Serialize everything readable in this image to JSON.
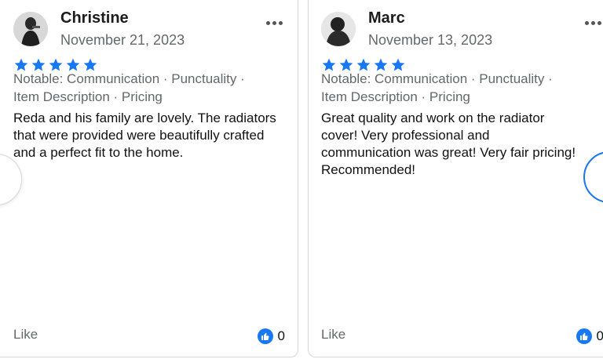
{
  "colors": {
    "star": "#1877f2",
    "muted_text": "#65676b",
    "like_badge": "#1877f2",
    "focus_ring": "#1877f2"
  },
  "reviews": [
    {
      "name": "Christine",
      "date": "November 21, 2023",
      "rating": 5,
      "notable": "Notable: Communication · Punctuality · Item Description · Pricing",
      "text": "Reda and his family are lovely. The radiators that were provided were beautifully crafted and a perfect fit to the home.",
      "like_label": "Like",
      "like_count": "0",
      "more_icon": "more-options-icon",
      "reaction_icon": "thumbs-up-icon"
    },
    {
      "name": "Marc",
      "date": "November 13, 2023",
      "rating": 5,
      "notable": "Notable: Communication · Punctuality · Item Description · Pricing",
      "text": "Great quality and work on the radiator cover! Very professional and communication was great! Very fair pricing! Recommended!",
      "like_label": "Like",
      "like_count": "0",
      "more_icon": "more-options-icon",
      "reaction_icon": "thumbs-up-icon"
    }
  ]
}
